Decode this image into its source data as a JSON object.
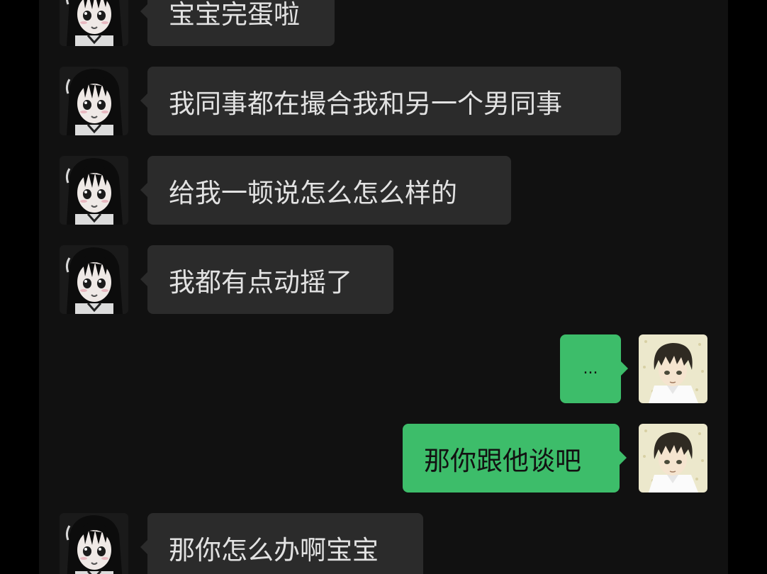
{
  "chat": {
    "messages": [
      {
        "sender": "other",
        "text": "宝宝完蛋啦",
        "avatar_icon": "anime-girl-avatar-icon"
      },
      {
        "sender": "other",
        "text": "我同事都在撮合我和另一个男同事",
        "avatar_icon": "anime-girl-avatar-icon"
      },
      {
        "sender": "other",
        "text": "给我一顿说怎么怎么样的",
        "avatar_icon": "anime-girl-avatar-icon"
      },
      {
        "sender": "other",
        "text": "我都有点动摇了",
        "avatar_icon": "anime-girl-avatar-icon"
      },
      {
        "sender": "self",
        "text": "...",
        "avatar_icon": "anime-boy-avatar-icon"
      },
      {
        "sender": "self",
        "text": "那你跟他谈吧",
        "avatar_icon": "anime-boy-avatar-icon"
      },
      {
        "sender": "other",
        "text": "那你怎么办啊宝宝",
        "avatar_icon": "anime-girl-avatar-icon"
      }
    ]
  },
  "colors": {
    "page_bg": "#000000",
    "chat_bg": "#111111",
    "incoming_bubble": "#2b2b2b",
    "incoming_text": "#e2e2e2",
    "outgoing_bubble": "#3dbd6a",
    "outgoing_text": "#121212"
  }
}
